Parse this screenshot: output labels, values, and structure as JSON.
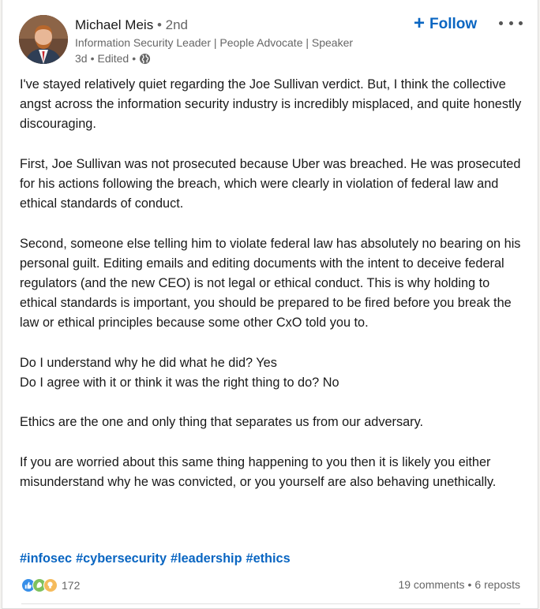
{
  "author": {
    "name": "Michael Meis",
    "degree": "• 2nd",
    "headline": "Information Security Leader | People Advocate | Speaker",
    "time": "3d",
    "edited": "Edited",
    "visibility_icon": "globe-icon"
  },
  "actions": {
    "follow_label": "Follow",
    "more_icon": "more-icon"
  },
  "post": {
    "paragraphs": [
      "I've stayed relatively quiet regarding the Joe Sullivan verdict. But, I think the collective angst across the information security industry is incredibly misplaced, and quite honestly discouraging.",
      "First, Joe Sullivan was not prosecuted because Uber was breached. He was prosecuted for his actions following the breach, which were clearly in violation of federal law and ethical standards of conduct.",
      "Second, someone else telling him to violate federal law has absolutely no bearing on his personal guilt. Editing emails and editing documents with the intent to deceive federal regulators (and the new CEO) is not legal or ethical conduct. This is why holding to ethical standards is important, you should be prepared to be fired before you break the law or ethical principles because some other CxO told you to.",
      "Do I understand why he did what he did? Yes",
      "Do I agree with it or think it was the right thing to do? No",
      "Ethics are the one and only thing that separates us from our adversary.",
      "If you are worried about this same thing happening to you then it is likely you either misunderstand why he was convicted, or you yourself are also behaving unethically."
    ],
    "hashtags": [
      "#infosec",
      "#cybersecurity",
      "#leadership",
      "#ethics"
    ]
  },
  "social": {
    "reaction_count": "172",
    "reaction_icons": [
      "like-icon",
      "support-icon",
      "insightful-icon"
    ],
    "comments": "19 comments",
    "separator": "•",
    "reposts": "6 reposts"
  },
  "colors": {
    "accent": "#0a66c2",
    "muted": "#666666",
    "text": "#191919"
  }
}
